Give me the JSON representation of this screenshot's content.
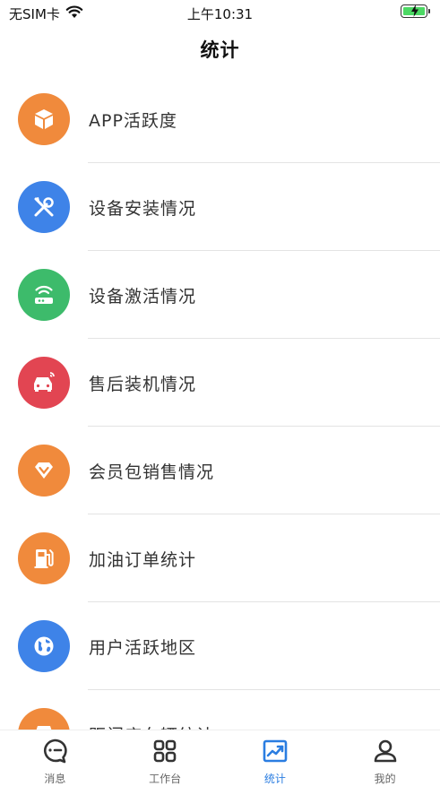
{
  "status_bar": {
    "carrier": "无SIM卡",
    "time": "上午10:31"
  },
  "nav": {
    "title": "统计"
  },
  "list": [
    {
      "label": "APP活跃度",
      "icon": "cube-icon",
      "color": "#f08a3c"
    },
    {
      "label": "设备安装情况",
      "icon": "tools-icon",
      "color": "#3e83e8"
    },
    {
      "label": "设备激活情况",
      "icon": "router-icon",
      "color": "#3dbb6b"
    },
    {
      "label": "售后装机情况",
      "icon": "car-icon",
      "color": "#e24552"
    },
    {
      "label": "会员包销售情况",
      "icon": "diamond-icon",
      "color": "#f08a3c"
    },
    {
      "label": "加油订单统计",
      "icon": "fuel-icon",
      "color": "#f08a3c"
    },
    {
      "label": "用户活跃地区",
      "icon": "globe-icon",
      "color": "#3e83e8"
    },
    {
      "label": "距门店车辆统计",
      "icon": "store-icon",
      "color": "#f08a3c"
    }
  ],
  "tabs": [
    {
      "label": "消息",
      "icon": "message-icon",
      "active": false
    },
    {
      "label": "工作台",
      "icon": "grid-icon",
      "active": false
    },
    {
      "label": "统计",
      "icon": "chart-icon",
      "active": true
    },
    {
      "label": "我的",
      "icon": "user-icon",
      "active": false
    }
  ],
  "colors": {
    "accent": "#2a7de1",
    "orange": "#f08a3c",
    "blue": "#3e83e8",
    "green": "#3dbb6b",
    "red": "#e24552"
  }
}
